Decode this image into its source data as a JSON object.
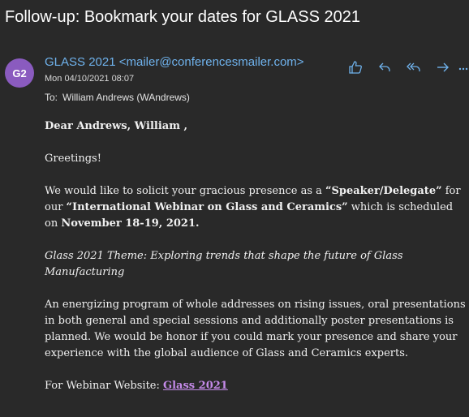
{
  "subject": "Follow-up: Bookmark your dates for GLASS 2021",
  "sender": {
    "initials": "G2",
    "display": "GLASS 2021 <mailer@conferencesmailer.com>",
    "date": "Mon 04/10/2021 08:07"
  },
  "to": {
    "label": "To:",
    "value": "William Andrews (WAndrews)"
  },
  "actions": {
    "icons": [
      "thumbs-up-icon",
      "reply-icon",
      "reply-all-icon",
      "forward-icon",
      "more-icon"
    ]
  },
  "body": {
    "salutation": "Dear Andrews, William ,",
    "greeting": "Greetings!",
    "p1_a": "We would like to solicit your gracious presence as a ",
    "p1_role": "“Speaker/Delegate”",
    "p1_b": " for our ",
    "p1_event": "“International Webinar on Glass and Ceramics”",
    "p1_c": " which is scheduled on ",
    "p1_date": "November 18-19, 2021.",
    "theme": "Glass 2021 Theme: Exploring trends that shape the future of Glass Manufacturing",
    "p2": "An energizing program of whole addresses on rising issues, oral presentations in both general and special sessions and additionally poster presentations is planned. We would be honor if you could mark your presence and share your experience with the global audience of Glass and Ceramics experts.",
    "website_label": "For Webinar Website: ",
    "website_link": "Glass 2021"
  },
  "colors": {
    "background": "#292929",
    "avatar": "#8a5bbf",
    "sender": "#6fb2ec",
    "link": "#c48ae8"
  }
}
